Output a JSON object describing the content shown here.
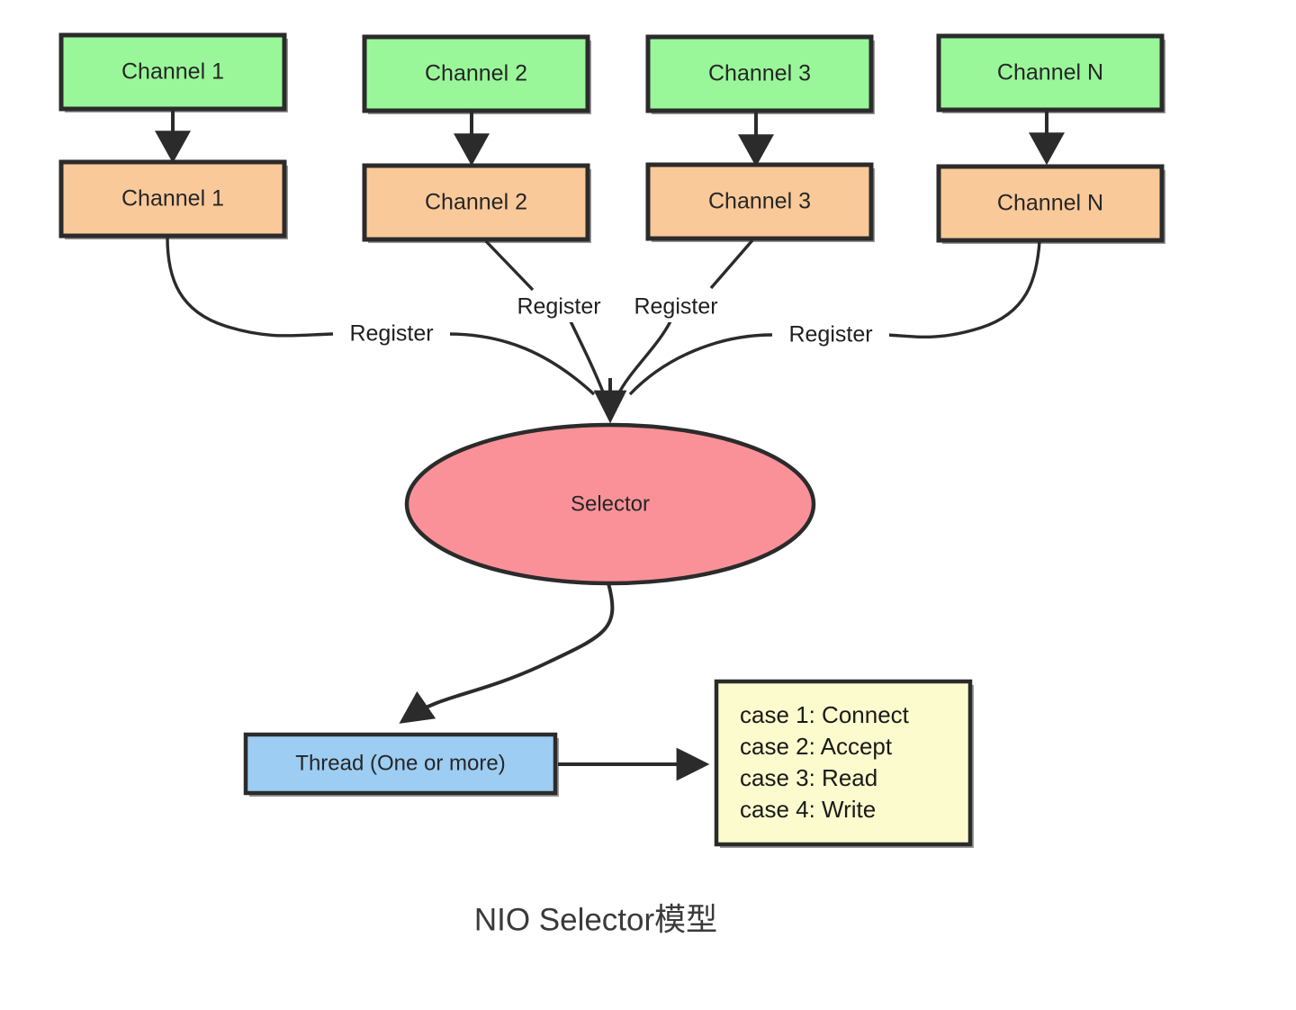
{
  "diagram": {
    "title": "NIO Selector模型",
    "colors": {
      "channel_top_fill": "#99f799",
      "channel_bottom_fill": "#fac999",
      "selector_fill": "#fa9199",
      "thread_fill": "#9dcdf2",
      "cases_fill": "#fcfbcd",
      "stroke": "#2b2b2b",
      "text": "#262626",
      "background": "#ffffff"
    },
    "channels_top": [
      {
        "label": "Channel 1"
      },
      {
        "label": "Channel 2"
      },
      {
        "label": "Channel 3"
      },
      {
        "label": "Channel N"
      }
    ],
    "channels_bottom": [
      {
        "label": "Channel 1"
      },
      {
        "label": "Channel 2"
      },
      {
        "label": "Channel 3"
      },
      {
        "label": "Channel N"
      }
    ],
    "register_labels": [
      {
        "label": "Register"
      },
      {
        "label": "Register"
      },
      {
        "label": "Register"
      },
      {
        "label": "Register"
      }
    ],
    "selector": {
      "label": "Selector"
    },
    "thread": {
      "label": "Thread (One or more)"
    },
    "cases": {
      "lines": [
        "case 1:  Connect",
        "case 2:  Accept",
        "case 3:  Read",
        "case 4:  Write"
      ]
    }
  }
}
